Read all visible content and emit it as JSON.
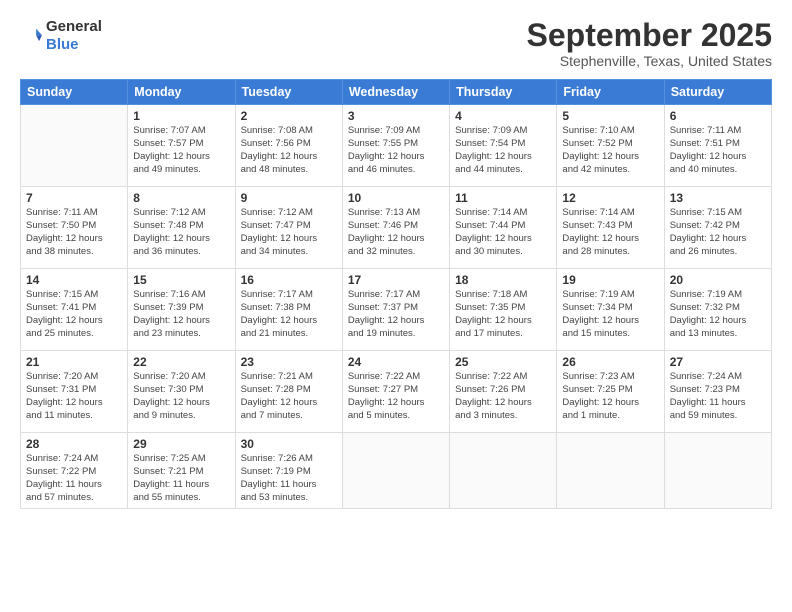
{
  "header": {
    "logo_general": "General",
    "logo_blue": "Blue",
    "title": "September 2025",
    "location": "Stephenville, Texas, United States"
  },
  "days_of_week": [
    "Sunday",
    "Monday",
    "Tuesday",
    "Wednesday",
    "Thursday",
    "Friday",
    "Saturday"
  ],
  "weeks": [
    [
      {
        "day": "",
        "info": ""
      },
      {
        "day": "1",
        "info": "Sunrise: 7:07 AM\nSunset: 7:57 PM\nDaylight: 12 hours\nand 49 minutes."
      },
      {
        "day": "2",
        "info": "Sunrise: 7:08 AM\nSunset: 7:56 PM\nDaylight: 12 hours\nand 48 minutes."
      },
      {
        "day": "3",
        "info": "Sunrise: 7:09 AM\nSunset: 7:55 PM\nDaylight: 12 hours\nand 46 minutes."
      },
      {
        "day": "4",
        "info": "Sunrise: 7:09 AM\nSunset: 7:54 PM\nDaylight: 12 hours\nand 44 minutes."
      },
      {
        "day": "5",
        "info": "Sunrise: 7:10 AM\nSunset: 7:52 PM\nDaylight: 12 hours\nand 42 minutes."
      },
      {
        "day": "6",
        "info": "Sunrise: 7:11 AM\nSunset: 7:51 PM\nDaylight: 12 hours\nand 40 minutes."
      }
    ],
    [
      {
        "day": "7",
        "info": "Sunrise: 7:11 AM\nSunset: 7:50 PM\nDaylight: 12 hours\nand 38 minutes."
      },
      {
        "day": "8",
        "info": "Sunrise: 7:12 AM\nSunset: 7:48 PM\nDaylight: 12 hours\nand 36 minutes."
      },
      {
        "day": "9",
        "info": "Sunrise: 7:12 AM\nSunset: 7:47 PM\nDaylight: 12 hours\nand 34 minutes."
      },
      {
        "day": "10",
        "info": "Sunrise: 7:13 AM\nSunset: 7:46 PM\nDaylight: 12 hours\nand 32 minutes."
      },
      {
        "day": "11",
        "info": "Sunrise: 7:14 AM\nSunset: 7:44 PM\nDaylight: 12 hours\nand 30 minutes."
      },
      {
        "day": "12",
        "info": "Sunrise: 7:14 AM\nSunset: 7:43 PM\nDaylight: 12 hours\nand 28 minutes."
      },
      {
        "day": "13",
        "info": "Sunrise: 7:15 AM\nSunset: 7:42 PM\nDaylight: 12 hours\nand 26 minutes."
      }
    ],
    [
      {
        "day": "14",
        "info": "Sunrise: 7:15 AM\nSunset: 7:41 PM\nDaylight: 12 hours\nand 25 minutes."
      },
      {
        "day": "15",
        "info": "Sunrise: 7:16 AM\nSunset: 7:39 PM\nDaylight: 12 hours\nand 23 minutes."
      },
      {
        "day": "16",
        "info": "Sunrise: 7:17 AM\nSunset: 7:38 PM\nDaylight: 12 hours\nand 21 minutes."
      },
      {
        "day": "17",
        "info": "Sunrise: 7:17 AM\nSunset: 7:37 PM\nDaylight: 12 hours\nand 19 minutes."
      },
      {
        "day": "18",
        "info": "Sunrise: 7:18 AM\nSunset: 7:35 PM\nDaylight: 12 hours\nand 17 minutes."
      },
      {
        "day": "19",
        "info": "Sunrise: 7:19 AM\nSunset: 7:34 PM\nDaylight: 12 hours\nand 15 minutes."
      },
      {
        "day": "20",
        "info": "Sunrise: 7:19 AM\nSunset: 7:32 PM\nDaylight: 12 hours\nand 13 minutes."
      }
    ],
    [
      {
        "day": "21",
        "info": "Sunrise: 7:20 AM\nSunset: 7:31 PM\nDaylight: 12 hours\nand 11 minutes."
      },
      {
        "day": "22",
        "info": "Sunrise: 7:20 AM\nSunset: 7:30 PM\nDaylight: 12 hours\nand 9 minutes."
      },
      {
        "day": "23",
        "info": "Sunrise: 7:21 AM\nSunset: 7:28 PM\nDaylight: 12 hours\nand 7 minutes."
      },
      {
        "day": "24",
        "info": "Sunrise: 7:22 AM\nSunset: 7:27 PM\nDaylight: 12 hours\nand 5 minutes."
      },
      {
        "day": "25",
        "info": "Sunrise: 7:22 AM\nSunset: 7:26 PM\nDaylight: 12 hours\nand 3 minutes."
      },
      {
        "day": "26",
        "info": "Sunrise: 7:23 AM\nSunset: 7:25 PM\nDaylight: 12 hours\nand 1 minute."
      },
      {
        "day": "27",
        "info": "Sunrise: 7:24 AM\nSunset: 7:23 PM\nDaylight: 11 hours\nand 59 minutes."
      }
    ],
    [
      {
        "day": "28",
        "info": "Sunrise: 7:24 AM\nSunset: 7:22 PM\nDaylight: 11 hours\nand 57 minutes."
      },
      {
        "day": "29",
        "info": "Sunrise: 7:25 AM\nSunset: 7:21 PM\nDaylight: 11 hours\nand 55 minutes."
      },
      {
        "day": "30",
        "info": "Sunrise: 7:26 AM\nSunset: 7:19 PM\nDaylight: 11 hours\nand 53 minutes."
      },
      {
        "day": "",
        "info": ""
      },
      {
        "day": "",
        "info": ""
      },
      {
        "day": "",
        "info": ""
      },
      {
        "day": "",
        "info": ""
      }
    ]
  ]
}
